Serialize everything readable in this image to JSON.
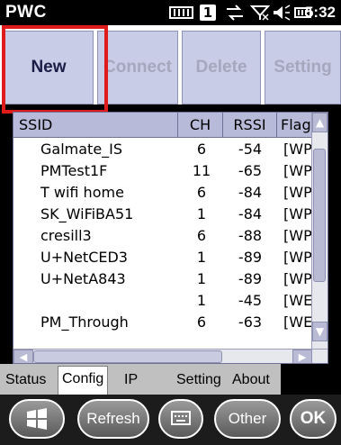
{
  "status_bar": {
    "app_title": "PWC",
    "icons": [
      "battery-strip-icon",
      "signal-one-icon",
      "sync-arrows-icon",
      "no-signal-icon",
      "volume-icon",
      "battery-icon"
    ],
    "signal_badge": "1",
    "time": "5:32"
  },
  "toolbar": {
    "new_label": "New",
    "connect_label": "Connect",
    "delete_label": "Delete",
    "setting_label": "Setting"
  },
  "table": {
    "columns": [
      "SSID",
      "CH",
      "RSSI",
      "Flags"
    ],
    "rows": [
      {
        "ssid": "Galmate_IS",
        "ch": "6",
        "rssi": "-54",
        "flags": "[WPA"
      },
      {
        "ssid": "PMTest1F",
        "ch": "11",
        "rssi": "-65",
        "flags": "[WPA"
      },
      {
        "ssid": "T wifi home",
        "ch": "6",
        "rssi": "-84",
        "flags": "[WPA"
      },
      {
        "ssid": "SK_WiFiBA51",
        "ch": "1",
        "rssi": "-84",
        "flags": "[WPA"
      },
      {
        "ssid": "cresill3",
        "ch": "6",
        "rssi": "-88",
        "flags": "[WPA"
      },
      {
        "ssid": "U+NetCED3",
        "ch": "1",
        "rssi": "-89",
        "flags": "[WPA"
      },
      {
        "ssid": "U+NetA843",
        "ch": "1",
        "rssi": "-89",
        "flags": "[WPA"
      },
      {
        "ssid": "",
        "ch": "1",
        "rssi": "-45",
        "flags": "[WE"
      },
      {
        "ssid": "PM_Through",
        "ch": "6",
        "rssi": "-63",
        "flags": "[WE"
      }
    ]
  },
  "tabs": [
    "Status",
    "Config",
    "IP",
    "Setting",
    "About"
  ],
  "selected_tab": "Config",
  "bottom_bar": {
    "start_icon": "windows-start-icon",
    "refresh_label": "Refresh",
    "keyboard_icon": "keyboard-icon",
    "other_label": "Other",
    "ok_label": "OK"
  },
  "colors": {
    "highlight": "#e01b1b",
    "toolbar_button": "#c9cce6",
    "header": "#b7bad8"
  }
}
